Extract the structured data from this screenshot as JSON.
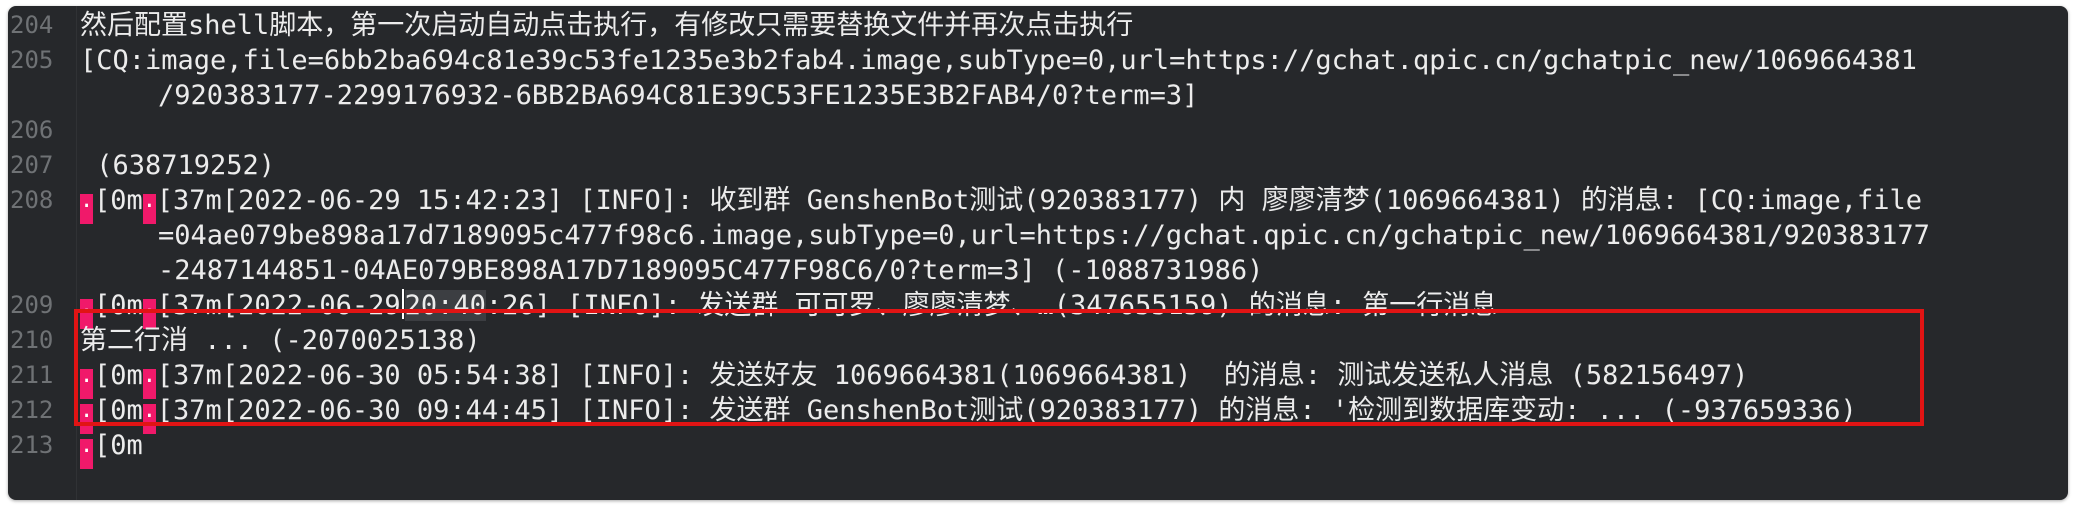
{
  "editor": {
    "lines": [
      {
        "num": "204",
        "text": "然后配置shell脚本，第一次启动自动点击执行，有修改只需要替换文件并再次点击执行"
      },
      {
        "num": "205",
        "text": "[CQ:image,file=6bb2ba694c81e39c53fe1235e3b2fab4.image,subType=0,url=https://gchat.qpic.cn/gchatpic_new/1069664381"
      },
      {
        "num": "",
        "text": "/920383177-2299176932-6BB2BA694C81E39C53FE1235E3B2FAB4/0?term=3]"
      },
      {
        "num": "206",
        "text": ""
      },
      {
        "num": "207",
        "text": " (638719252)"
      },
      {
        "num": "208",
        "esc1": "[0m",
        "esc2": "[37m",
        "text": "[2022-06-29 15:42:23] [INFO]: 收到群 GenshenBot测试(920383177) 内 廖廖清梦(1069664381) 的消息: [CQ:image,file"
      },
      {
        "num": "",
        "text": "=04ae079be898a17d7189095c477f98c6.image,subType=0,url=https://gchat.qpic.cn/gchatpic_new/1069664381/920383177"
      },
      {
        "num": "",
        "text": "-2487144851-04AE079BE898A17D7189095C477F98C6/0?term=3] (-1088731986)"
      },
      {
        "num": "209",
        "esc1": "[0m",
        "esc2": "[37m",
        "pre": "[2022-06-29",
        "word": "20:40",
        "post": ":26] [INFO]: 发送群 可可罗、廖廖清梦、…(347655159) 的消息: 第一行消息"
      },
      {
        "num": "210",
        "text": "第二行消 ... (-2070025138)"
      },
      {
        "num": "211",
        "esc1": "[0m",
        "esc2": "[37m",
        "text": "[2022-06-30 05:54:38] [INFO]: 发送好友 1069664381(1069664381)  的消息: 测试发送私人消息 (582156497)"
      },
      {
        "num": "212",
        "esc1": "[0m",
        "esc2": "[37m",
        "text": "[2022-06-30 09:44:45] [INFO]: 发送群 GenshenBot测试(920383177) 的消息: '检测到数据库变动: ... (-937659336)"
      },
      {
        "num": "213",
        "esc1": "[0m",
        "text": ""
      }
    ],
    "colors": {
      "background": "#26282b",
      "text": "#ececec",
      "gutter": "#6f7275",
      "escape_marker": "#f0196a",
      "highlight_box": "#e11414"
    }
  }
}
